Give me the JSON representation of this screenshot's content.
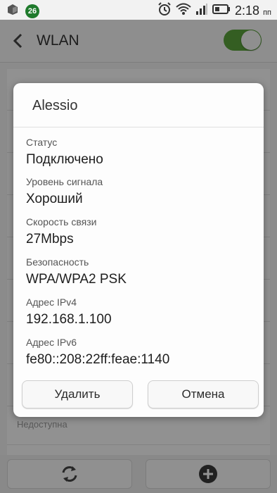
{
  "status_bar": {
    "notification_count": "26",
    "time": "2:18",
    "time_suffix": "пп"
  },
  "app_bar": {
    "title": "WLAN",
    "wifi_enabled": true,
    "accent_color": "#5aa23b"
  },
  "background_list": {
    "subtitle_visible": "Недоступна"
  },
  "dialog": {
    "title": "Alessio",
    "fields": [
      {
        "label": "Статус",
        "value": "Подключено"
      },
      {
        "label": "Уровень сигнала",
        "value": "Хороший"
      },
      {
        "label": "Скорость связи",
        "value": "27Mbps"
      },
      {
        "label": "Безопасность",
        "value": "WPA/WPA2 PSK"
      },
      {
        "label": "Адрес IPv4",
        "value": "192.168.1.100"
      },
      {
        "label": "Адрес IPv6",
        "value": "fe80::208:22ff:feae:1140"
      }
    ],
    "delete_label": "Удалить",
    "cancel_label": "Отмена"
  },
  "bottom_bar": {
    "left_icon": "refresh-icon",
    "right_icon": "add-icon"
  }
}
